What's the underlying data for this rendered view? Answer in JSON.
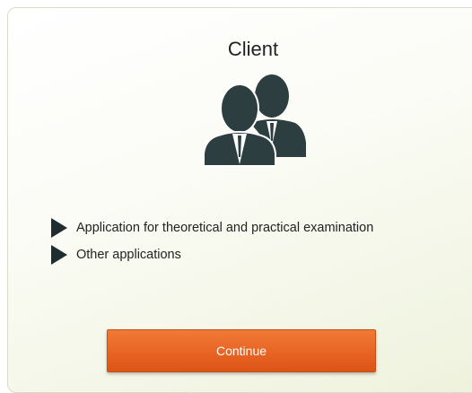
{
  "card": {
    "title": "Client",
    "icon": "users-icon",
    "icon_color": "#2c3e3f",
    "options": [
      {
        "label": "Application for theoretical and practical examination",
        "icon": "triangle-right-icon"
      },
      {
        "label": "Other applications",
        "icon": "triangle-right-icon"
      }
    ],
    "continue_label": "Continue",
    "button_color": "#e86424"
  }
}
